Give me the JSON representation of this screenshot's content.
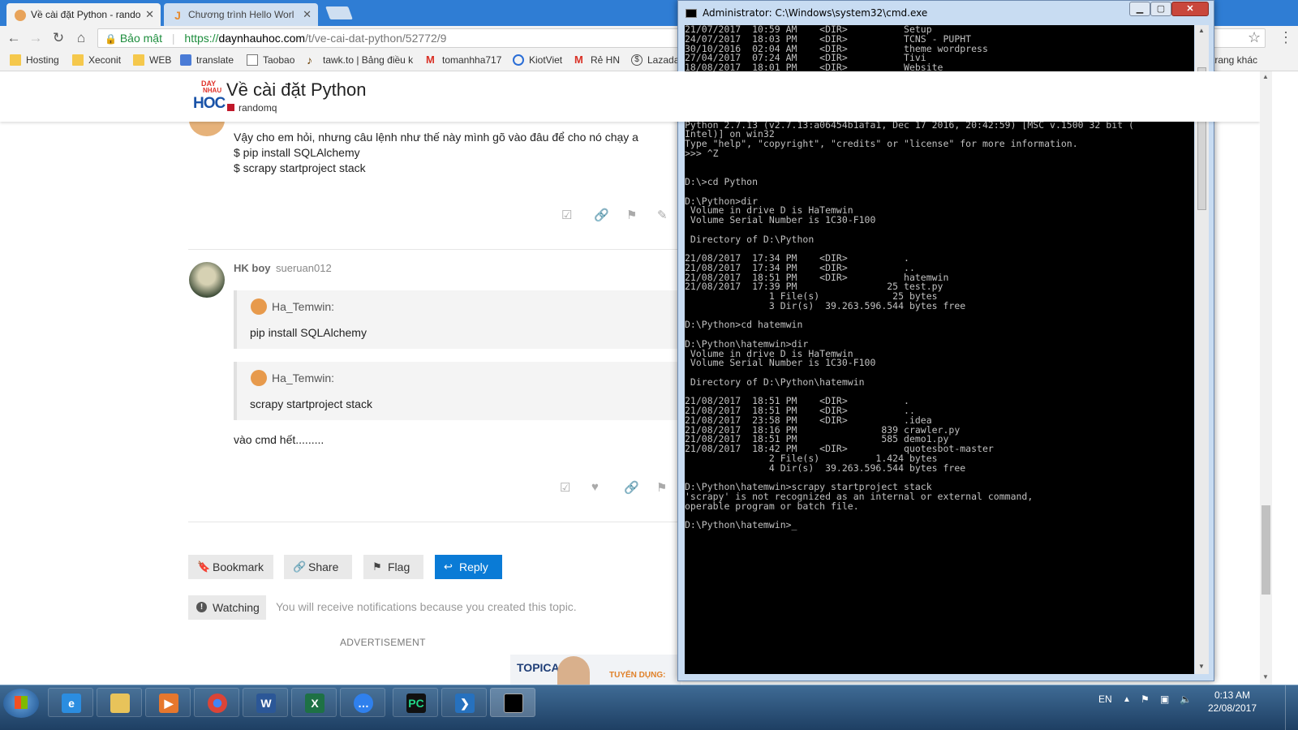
{
  "browser": {
    "tabs": [
      {
        "title": "Về cài đặt Python - rando",
        "active": true
      },
      {
        "title": "Chương trình Hello Worl",
        "active": false
      }
    ],
    "secure_label": "Bảo mật",
    "url_https": "https://",
    "url_host": "daynhauhoc.com",
    "url_path": "/t/ve-cai-dat-python/52772/9",
    "bookmarks": [
      {
        "label": "Hosting",
        "icon": "folder-icon"
      },
      {
        "label": "Xeconit",
        "icon": "folder-icon"
      },
      {
        "label": "WEB",
        "icon": "folder-icon"
      },
      {
        "label": "translate",
        "icon": "translate-icon"
      },
      {
        "label": "Taobao",
        "icon": "page-icon"
      },
      {
        "label": "tawk.to | Bảng điều k",
        "icon": "tawk-icon"
      },
      {
        "label": "tomanhha717",
        "icon": "gmail-icon"
      },
      {
        "label": "KiotViet",
        "icon": "kiotviet-icon"
      },
      {
        "label": "Rẻ HN",
        "icon": "gmail-icon"
      },
      {
        "label": "Lazada",
        "icon": "dollar-icon"
      }
    ],
    "other_bookmarks": "trang khác"
  },
  "page": {
    "logo": {
      "line1": "DAY",
      "line2": "NHAU",
      "line3": "HOC"
    },
    "topic_title": "Về cài đặt Python",
    "category": "randomq",
    "post1_lines": [
      "Vậy cho em hỏi, nhưng câu lệnh như thế này mình gõ vào đâu để cho nó chạy a",
      "$ pip install SQLAlchemy",
      "$ scrapy startproject stack"
    ],
    "post2": {
      "name": "HK boy",
      "username": "sueruan012",
      "quotes": [
        {
          "author": "Ha_Temwin:",
          "text": "pip install SQLAlchemy"
        },
        {
          "author": "Ha_Temwin:",
          "text": "scrapy startproject stack"
        }
      ],
      "body": "vào cmd hết........."
    },
    "buttons": {
      "bookmark": "Bookmark",
      "share": "Share",
      "flag": "Flag",
      "reply": "Reply"
    },
    "watching": {
      "label": "Watching",
      "note": "You will receive notifications because you created this topic."
    },
    "advertisement": "ADVERTISEMENT",
    "ad": {
      "brand": "TOPICA",
      "hiring": "TUYỂN DỤNG:"
    }
  },
  "cmd": {
    "title": "Administrator: C:\\Windows\\system32\\cmd.exe",
    "lines": [
      "21/07/2017  10:59 AM    <DIR>          Setup",
      "24/07/2017  18:03 PM    <DIR>          TCNS - PUPHT",
      "30/10/2016  02:04 AM    <DIR>          theme wordpress",
      "27/04/2017  07:24 AM    <DIR>          Tivi",
      "18/08/2017  18:01 PM    <DIR>          Website",
      "21/07/2017  05:17 AM    <DIR>          Youtube",
      "               0 File(s)              0 bytes",
      "               9 Dir(s)  39.263.596.544 bytes free",
      "",
      "D:\\>python",
      "Python 2.7.13 (v2.7.13:a06454b1afa1, Dec 17 2016, 20:42:59) [MSC v.1500 32 bit (",
      "Intel)] on win32",
      "Type \"help\", \"copyright\", \"credits\" or \"license\" for more information.",
      ">>> ^Z",
      "",
      "",
      "D:\\>cd Python",
      "",
      "D:\\Python>dir",
      " Volume in drive D is HaTemwin",
      " Volume Serial Number is 1C30-F100",
      "",
      " Directory of D:\\Python",
      "",
      "21/08/2017  17:34 PM    <DIR>          .",
      "21/08/2017  17:34 PM    <DIR>          ..",
      "21/08/2017  18:51 PM    <DIR>          hatemwin",
      "21/08/2017  17:39 PM                25 test.py",
      "               1 File(s)             25 bytes",
      "               3 Dir(s)  39.263.596.544 bytes free",
      "",
      "D:\\Python>cd hatemwin",
      "",
      "D:\\Python\\hatemwin>dir",
      " Volume in drive D is HaTemwin",
      " Volume Serial Number is 1C30-F100",
      "",
      " Directory of D:\\Python\\hatemwin",
      "",
      "21/08/2017  18:51 PM    <DIR>          .",
      "21/08/2017  18:51 PM    <DIR>          ..",
      "21/08/2017  23:58 PM    <DIR>          .idea",
      "21/08/2017  18:16 PM               839 crawler.py",
      "21/08/2017  18:51 PM               585 demo1.py",
      "21/08/2017  18:42 PM    <DIR>          quotesbot-master",
      "               2 File(s)          1.424 bytes",
      "               4 Dir(s)  39.263.596.544 bytes free",
      "",
      "D:\\Python\\hatemwin>scrapy startproject stack",
      "'scrapy' is not recognized as an internal or external command,",
      "operable program or batch file.",
      "",
      "D:\\Python\\hatemwin>_"
    ]
  },
  "taskbar": {
    "language": "EN",
    "time": "0:13 AM",
    "date": "22/08/2017"
  }
}
